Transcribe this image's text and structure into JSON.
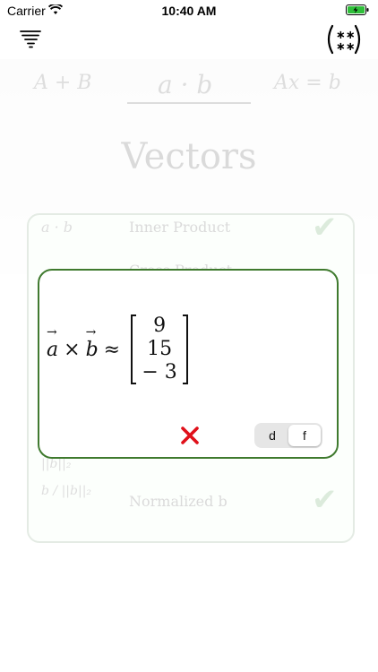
{
  "status": {
    "carrier": "Carrier",
    "time": "10:40 AM"
  },
  "background": {
    "top_left_formula": "A + B",
    "top_center_formula": "a · b",
    "top_right_formula": "Ax = b",
    "page_title": "Vectors",
    "row1_formula": "a · b",
    "row1_label": "Inner Product",
    "row2_label": "Cross Product",
    "row3_formula": "||b||₂",
    "row4_formula": "b / ||b||₂",
    "row4_label": "Normalized b"
  },
  "modal": {
    "lhs_a": "a",
    "times": "×",
    "lhs_b": "b",
    "approx": "≈",
    "vector": [
      "9",
      "15",
      "− 3"
    ],
    "segment": {
      "options": [
        "d",
        "f"
      ],
      "selected": "f"
    }
  },
  "colors": {
    "accent_green": "#3f7a2e",
    "close_red": "#e0101a"
  }
}
